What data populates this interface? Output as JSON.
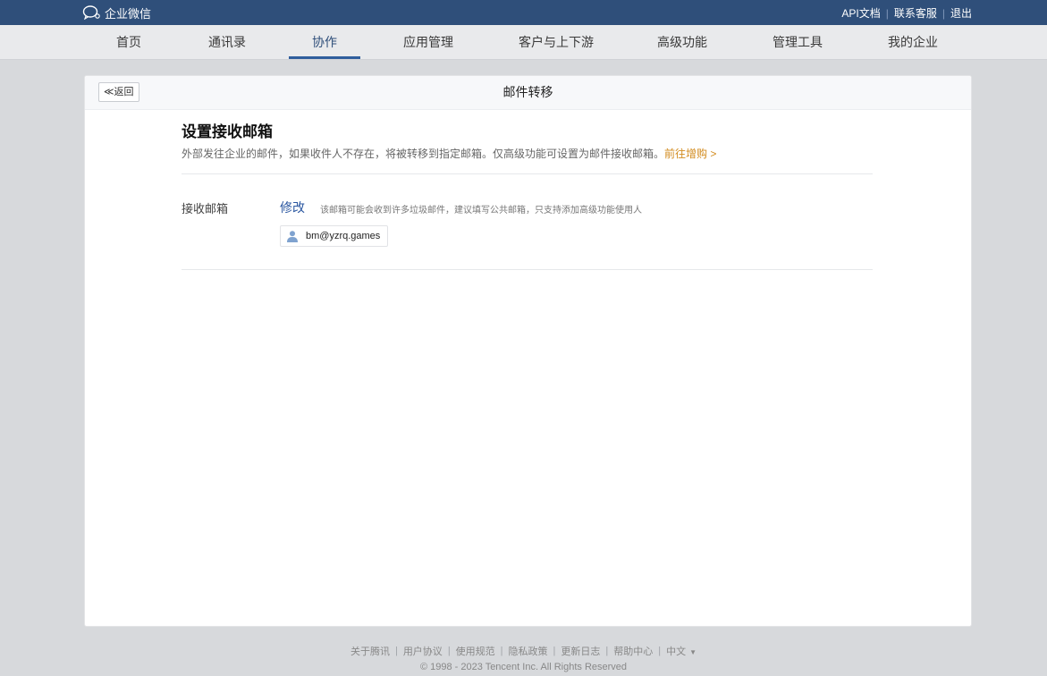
{
  "topbar": {
    "logo_text": "企业微信",
    "links": [
      "API文档",
      "联系客服",
      "退出"
    ]
  },
  "nav": {
    "items": [
      "首页",
      "通讯录",
      "协作",
      "应用管理",
      "客户与上下游",
      "高级功能",
      "管理工具",
      "我的企业"
    ],
    "active": "协作"
  },
  "panel": {
    "back_label": "≪返回",
    "title": "邮件转移"
  },
  "section": {
    "title": "设置接收邮箱",
    "desc": "外部发往企业的邮件，如果收件人不存在，将被转移到指定邮箱。仅高级功能可设置为邮件接收邮箱。",
    "upgrade_link": "前往增购 >"
  },
  "receive": {
    "label": "接收邮箱",
    "edit_label": "修改",
    "hint": "该邮箱可能会收到许多垃圾邮件，建议填写公共邮箱，只支持添加高级功能使用人",
    "email": "bm@yzrq.games",
    "icon": "user-icon"
  },
  "footer": {
    "links": [
      "关于腾讯",
      "用户协议",
      "使用规范",
      "隐私政策",
      "更新日志",
      "帮助中心"
    ],
    "language": "中文",
    "copyright": "© 1998 - 2023 Tencent Inc. All Rights Reserved"
  },
  "colors": {
    "topbar": "#2f4f7a",
    "accent": "#2a56a0",
    "upgrade": "#d28b1e",
    "background": "#d7d9dc"
  }
}
